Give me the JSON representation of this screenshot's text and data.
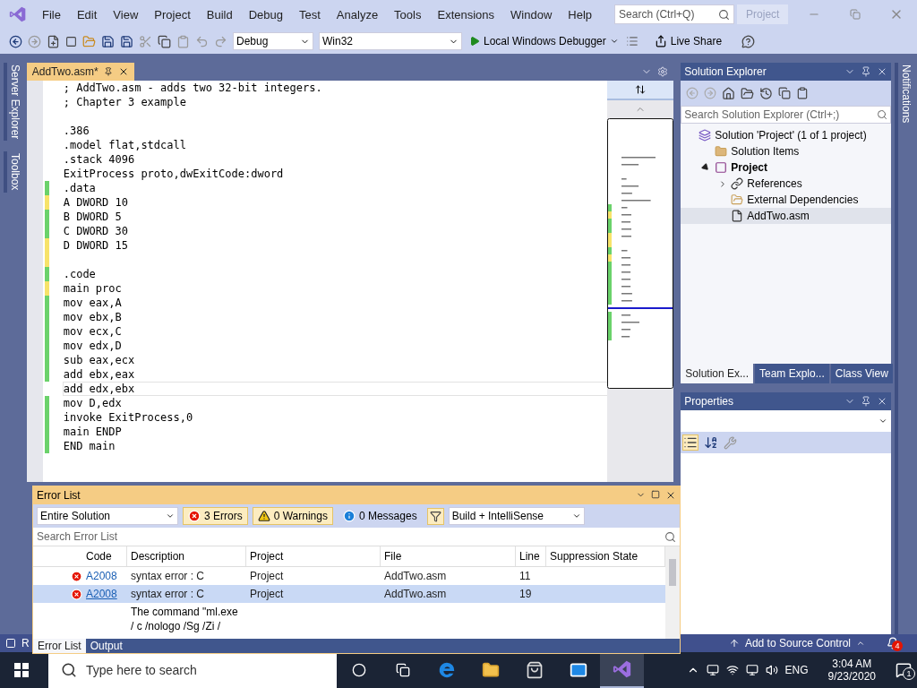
{
  "menu": {
    "items": [
      "File",
      "Edit",
      "View",
      "Project",
      "Build",
      "Debug",
      "Test",
      "Analyze",
      "Tools",
      "Extensions",
      "Window",
      "Help"
    ],
    "search": {
      "placeholder": "Search (Ctrl+Q)"
    },
    "project_badge": "Project"
  },
  "toolbar": {
    "configuration": "Debug",
    "platform": "Win32",
    "run_button": "Local Windows Debugger",
    "live_share": "Live Share"
  },
  "side_tabs": [
    "Server Explorer",
    "Toolbox"
  ],
  "document_tabs": [
    {
      "label": "AddTwo.asm*",
      "selected": true
    }
  ],
  "code_lines": [
    {
      "text": "; AddTwo.asm - adds two 32-bit integers.",
      "modified": false,
      "current": false
    },
    {
      "text": "; Chapter 3 example",
      "modified": false,
      "current": false
    },
    {
      "modified": false,
      "current": false
    },
    {
      "text": ".386",
      "modified": false,
      "current": false
    },
    {
      "text": ".model flat,stdcall",
      "modified": false,
      "current": false
    },
    {
      "text": ".stack 4096",
      "modified": false,
      "current": false
    },
    {
      "text": "ExitProcess proto,dwExitCode:dword",
      "modified": false,
      "current": false
    },
    {
      "text": ".data",
      "modified": true,
      "saved": true,
      "current": false
    },
    {
      "text": "A DWORD 10",
      "modified": true,
      "saved": false,
      "current": false
    },
    {
      "text": "B DWORD 5",
      "modified": true,
      "saved": true,
      "current": false
    },
    {
      "text": "C DWORD 30",
      "modified": true,
      "saved": true,
      "current": false
    },
    {
      "text": "D DWORD 15",
      "modified": true,
      "saved": false,
      "current": false
    },
    {
      "modified": true,
      "saved": false,
      "current": false
    },
    {
      "text": ".code",
      "modified": true,
      "saved": true,
      "current": false
    },
    {
      "text": "main proc",
      "modified": true,
      "saved": false,
      "current": false
    },
    {
      "text": "mov eax,A",
      "modified": true,
      "saved": true,
      "current": false
    },
    {
      "text": "mov ebx,B",
      "modified": true,
      "saved": true,
      "current": false
    },
    {
      "text": "mov ecx,C",
      "modified": true,
      "saved": true,
      "current": false
    },
    {
      "text": "mov edx,D",
      "modified": true,
      "saved": true,
      "current": false
    },
    {
      "text": "sub eax,ecx",
      "modified": true,
      "saved": true,
      "current": false
    },
    {
      "text": "add ebx,eax",
      "modified": true,
      "saved": true,
      "current": false
    },
    {
      "text": "add edx,ebx",
      "modified": false,
      "current": true
    },
    {
      "text": "mov D,edx",
      "modified": true,
      "saved": true,
      "current": false
    },
    {
      "text": "invoke ExitProcess,0",
      "modified": true,
      "saved": true,
      "current": false
    },
    {
      "text": "main ENDP",
      "modified": true,
      "saved": true,
      "current": false
    },
    {
      "text": "END main",
      "modified": true,
      "saved": true,
      "current": false
    }
  ],
  "solution_explorer": {
    "title": "Solution Explorer",
    "search": {
      "placeholder": "Search Solution Explorer (Ctrl+;)"
    },
    "tree": [
      {
        "label": "Solution 'Project' (1 of 1 project)",
        "kind": "solution",
        "selected": false,
        "children": [
          {
            "label": "Solution Items",
            "kind": "folder",
            "selected": false
          },
          {
            "label": "Project",
            "kind": "project",
            "expanded": true,
            "selected": false,
            "children": [
              {
                "label": "References",
                "kind": "references",
                "expanded": false,
                "selected": false
              },
              {
                "label": "External Dependencies",
                "kind": "external",
                "selected": false
              },
              {
                "label": "AddTwo.asm",
                "kind": "file",
                "selected": true
              }
            ]
          }
        ]
      }
    ],
    "tabs": [
      {
        "label": "Solution Ex...",
        "selected": true
      },
      {
        "label": "Team Explo...",
        "selected": false
      },
      {
        "label": "Class View",
        "selected": false
      }
    ]
  },
  "properties": {
    "title": "Properties"
  },
  "notifications_tab": "Notifications",
  "error_list": {
    "title": "Error List",
    "scope": "Entire Solution",
    "filters": [
      {
        "kind": "error",
        "label": "3 Errors",
        "on": true
      },
      {
        "kind": "warning",
        "label": "0 Warnings",
        "on": true
      },
      {
        "kind": "message",
        "label": "0 Messages",
        "on": false
      }
    ],
    "source": "Build + IntelliSense",
    "search": {
      "placeholder": "Search Error List"
    },
    "columns": [
      "Code",
      "Description",
      "Project",
      "File",
      "Line",
      "Suppression State"
    ],
    "rows": [
      {
        "kind": "error",
        "code": "A2008",
        "description": "syntax error : C",
        "project": "Project",
        "file": "AddTwo.asm",
        "line": "11",
        "selected": false
      },
      {
        "kind": "error",
        "code": "A2008",
        "description": "syntax error : C",
        "project": "Project",
        "file": "AddTwo.asm",
        "line": "19",
        "selected": true
      },
      {
        "kind": "plain",
        "description": "The command \"ml.exe / c /nologo /Sg /Zi /",
        "selected": false
      }
    ],
    "tabs": [
      {
        "label": "Error List",
        "selected": true
      },
      {
        "label": "Output",
        "selected": false
      }
    ]
  },
  "status_bar": {
    "left_text": "R",
    "source_control": "Add to Source Control",
    "notification_count": "4"
  },
  "taskbar": {
    "search": {
      "placeholder": "Type here to search"
    },
    "language": "ENG",
    "time": "3:04 AM",
    "date": "9/23/2020",
    "action_center_count": "1"
  }
}
